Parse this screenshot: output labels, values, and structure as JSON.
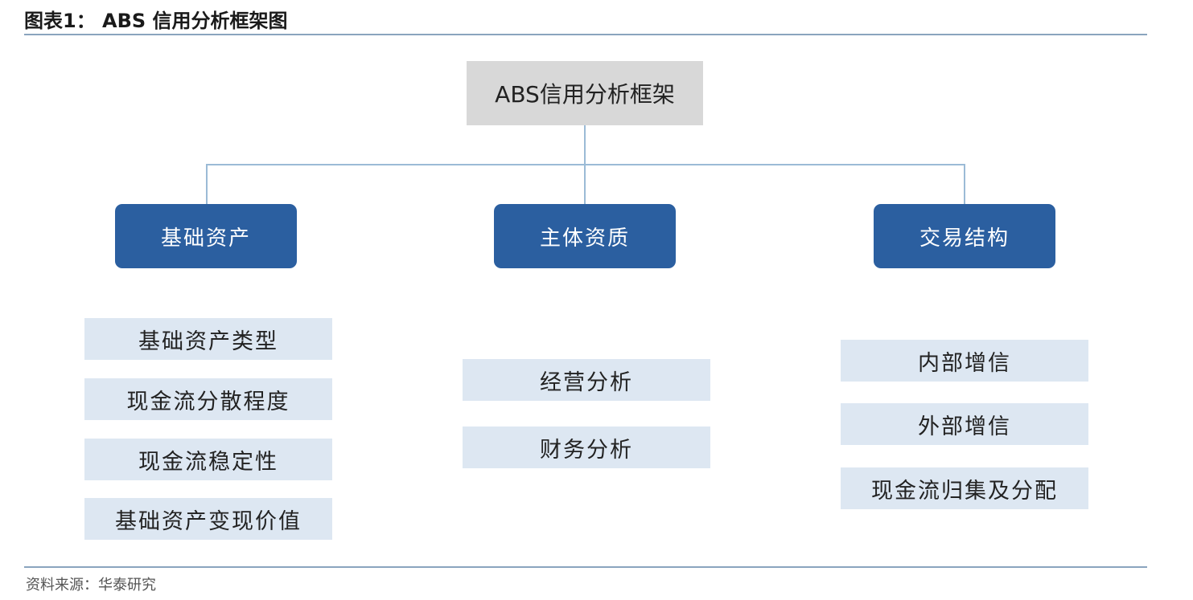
{
  "header": {
    "title": "图表1：  ABS 信用分析框架图"
  },
  "root": {
    "label": "ABS信用分析框架"
  },
  "categories": [
    {
      "label": "基础资产",
      "items": [
        "基础资产类型",
        "现金流分散程度",
        "现金流稳定性",
        "基础资产变现价值"
      ]
    },
    {
      "label": "主体资质",
      "items": [
        "经营分析",
        "财务分析"
      ]
    },
    {
      "label": "交易结构",
      "items": [
        "内部增信",
        "外部增信",
        "现金流归集及分配"
      ]
    }
  ],
  "footer": {
    "source": "资料来源：华泰研究"
  },
  "colors": {
    "category_fill": "#2b5fa0",
    "item_fill": "#dde7f2",
    "root_fill": "#d8d8d8",
    "connector": "#9bbbd6"
  }
}
